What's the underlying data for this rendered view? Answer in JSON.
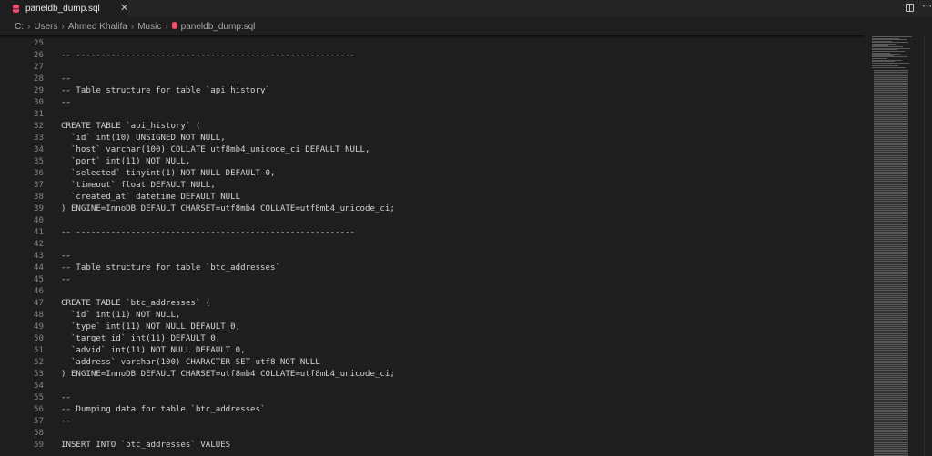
{
  "tab": {
    "file_name": "paneldb_dump.sql",
    "close_glyph": "✕",
    "icon": "database-icon",
    "icon_color": "#f14c6a"
  },
  "toolbar": {
    "split_icon": "split-editor-icon",
    "more_glyph": "⋯"
  },
  "breadcrumb": {
    "items": [
      "C:",
      "Users",
      "Ahmed Khalifa",
      "Music",
      "paneldb_dump.sql"
    ],
    "separator": "›"
  },
  "editor": {
    "lines": [
      {
        "n": "25",
        "text": ""
      },
      {
        "n": "26",
        "text": "-- --------------------------------------------------------"
      },
      {
        "n": "27",
        "text": ""
      },
      {
        "n": "28",
        "text": "--"
      },
      {
        "n": "29",
        "text": "-- Table structure for table `api_history`"
      },
      {
        "n": "30",
        "text": "--"
      },
      {
        "n": "31",
        "text": ""
      },
      {
        "n": "32",
        "text": "CREATE TABLE `api_history` ("
      },
      {
        "n": "33",
        "text": "  `id` int(10) UNSIGNED NOT NULL,"
      },
      {
        "n": "34",
        "text": "  `host` varchar(100) COLLATE utf8mb4_unicode_ci DEFAULT NULL,"
      },
      {
        "n": "35",
        "text": "  `port` int(11) NOT NULL,"
      },
      {
        "n": "36",
        "text": "  `selected` tinyint(1) NOT NULL DEFAULT 0,"
      },
      {
        "n": "37",
        "text": "  `timeout` float DEFAULT NULL,"
      },
      {
        "n": "38",
        "text": "  `created_at` datetime DEFAULT NULL"
      },
      {
        "n": "39",
        "text": ") ENGINE=InnoDB DEFAULT CHARSET=utf8mb4 COLLATE=utf8mb4_unicode_ci;"
      },
      {
        "n": "40",
        "text": ""
      },
      {
        "n": "41",
        "text": "-- --------------------------------------------------------"
      },
      {
        "n": "42",
        "text": ""
      },
      {
        "n": "43",
        "text": "--"
      },
      {
        "n": "44",
        "text": "-- Table structure for table `btc_addresses`"
      },
      {
        "n": "45",
        "text": "--"
      },
      {
        "n": "46",
        "text": ""
      },
      {
        "n": "47",
        "text": "CREATE TABLE `btc_addresses` ("
      },
      {
        "n": "48",
        "text": "  `id` int(11) NOT NULL,"
      },
      {
        "n": "49",
        "text": "  `type` int(11) NOT NULL DEFAULT 0,"
      },
      {
        "n": "50",
        "text": "  `target_id` int(11) DEFAULT 0,"
      },
      {
        "n": "51",
        "text": "  `advid` int(11) NOT NULL DEFAULT 0,"
      },
      {
        "n": "52",
        "text": "  `address` varchar(100) CHARACTER SET utf8 NOT NULL"
      },
      {
        "n": "53",
        "text": ") ENGINE=InnoDB DEFAULT CHARSET=utf8mb4 COLLATE=utf8mb4_unicode_ci;"
      },
      {
        "n": "54",
        "text": ""
      },
      {
        "n": "55",
        "text": "--"
      },
      {
        "n": "56",
        "text": "-- Dumping data for table `btc_addresses`"
      },
      {
        "n": "57",
        "text": "--"
      },
      {
        "n": "58",
        "text": ""
      },
      {
        "n": "59",
        "text": "INSERT INTO `btc_addresses` VALUES"
      }
    ]
  }
}
